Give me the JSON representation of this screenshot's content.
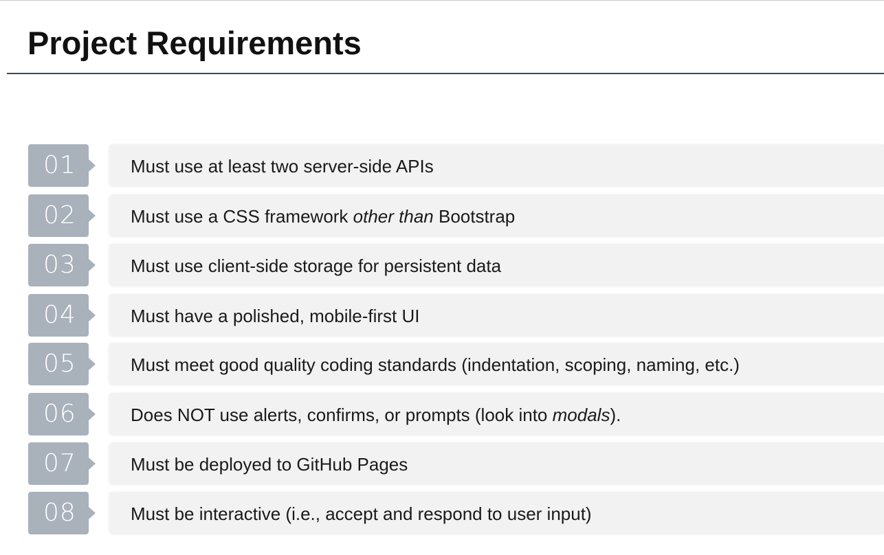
{
  "slide": {
    "title": "Project Requirements"
  },
  "requirements": [
    {
      "number": "01",
      "before": "Must use at least two server-side APIs",
      "emphasis": "",
      "after": ""
    },
    {
      "number": "02",
      "before": "Must use a CSS framework ",
      "emphasis": "other than",
      "after": " Bootstrap"
    },
    {
      "number": "03",
      "before": "Must use client-side storage for persistent data",
      "emphasis": "",
      "after": ""
    },
    {
      "number": "04",
      "before": "Must have a polished, mobile-first UI",
      "emphasis": "",
      "after": ""
    },
    {
      "number": "05",
      "before": "Must meet good quality coding standards (indentation, scoping, naming, etc.)",
      "emphasis": "",
      "after": ""
    },
    {
      "number": "06",
      "before": "Does NOT use alerts, confirms, or prompts (look into ",
      "emphasis": "modals",
      "after": ")."
    },
    {
      "number": "07",
      "before": "Must be deployed to GitHub Pages",
      "emphasis": "",
      "after": ""
    },
    {
      "number": "08",
      "before": "Must be interactive (i.e., accept and respond to user input)",
      "emphasis": "",
      "after": ""
    }
  ],
  "colors": {
    "badge": "#a9b1bb",
    "bar": "#f2f2f2",
    "rule": "#3b4a5a",
    "text": "#1a1a1a"
  }
}
